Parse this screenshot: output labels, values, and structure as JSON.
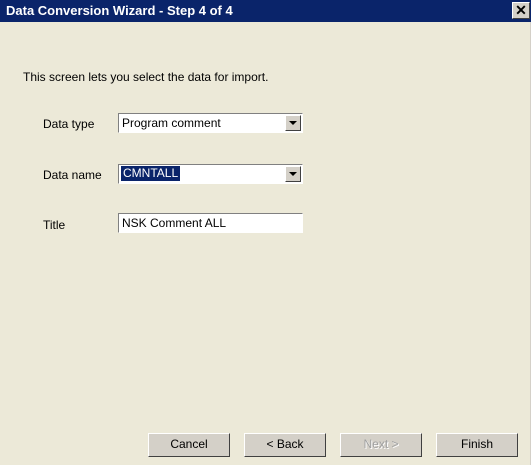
{
  "window": {
    "title": "Data Conversion Wizard - Step 4 of 4",
    "close_glyph": "✕"
  },
  "intro_text": "This screen lets you select the data for import.",
  "fields": {
    "data_type": {
      "label": "Data type",
      "value": "Program comment"
    },
    "data_name": {
      "label": "Data name",
      "value": "CMNTALL"
    },
    "title": {
      "label": "Title",
      "value": "NSK Comment ALL"
    }
  },
  "buttons": {
    "cancel": "Cancel",
    "back": "< Back",
    "next": "Next >",
    "finish": "Finish"
  },
  "colors": {
    "titlebar": "#0a246a",
    "dialog": "#ece9d8",
    "selection": "#0a246a"
  }
}
